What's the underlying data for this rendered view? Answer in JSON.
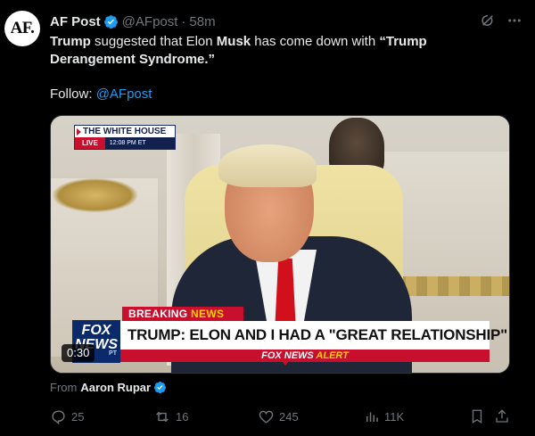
{
  "author": {
    "avatar_text": "AF.",
    "name": "AF Post",
    "handle": "@AFpost",
    "separator": "·",
    "time": "58m"
  },
  "tweet": {
    "segments": [
      {
        "text": "Trump",
        "bold": true
      },
      {
        "text": " suggested that Elon ",
        "bold": false
      },
      {
        "text": "Musk",
        "bold": true
      },
      {
        "text": " has come down with ",
        "bold": false
      },
      {
        "text": "“Trump Derangement Syndrome.”",
        "bold": true
      }
    ],
    "follow_prefix": "Follow: ",
    "follow_link": "@AFpost"
  },
  "media": {
    "badge_title": "THE WHITE HOUSE",
    "badge_live": "LIVE",
    "badge_time": "12:08 PM ET",
    "breaking_label": "BREAKING",
    "breaking_news": "NEWS",
    "network_logo": "FOX NEWS",
    "network_zone": "PT",
    "chyron": "TRUMP: ELON AND I HAD A \"GREAT RELATIONSHIP\"",
    "alert_prefix": "FOX NEWS",
    "alert_word": "ALERT",
    "duration": "0:30"
  },
  "attribution": {
    "prefix": "From",
    "name": "Aaron Rupar"
  },
  "actions": {
    "replies": "25",
    "reposts": "16",
    "likes": "245",
    "views": "11K"
  },
  "colors": {
    "accent": "#1d9bf0",
    "muted": "#71767b",
    "text": "#e7e9ea",
    "background": "#000000",
    "fox_red": "#c8102e"
  },
  "icons": [
    "verified-badge-icon",
    "grok-icon",
    "more-icon",
    "reply-icon",
    "repost-icon",
    "like-icon",
    "views-icon",
    "bookmark-icon",
    "share-icon"
  ]
}
